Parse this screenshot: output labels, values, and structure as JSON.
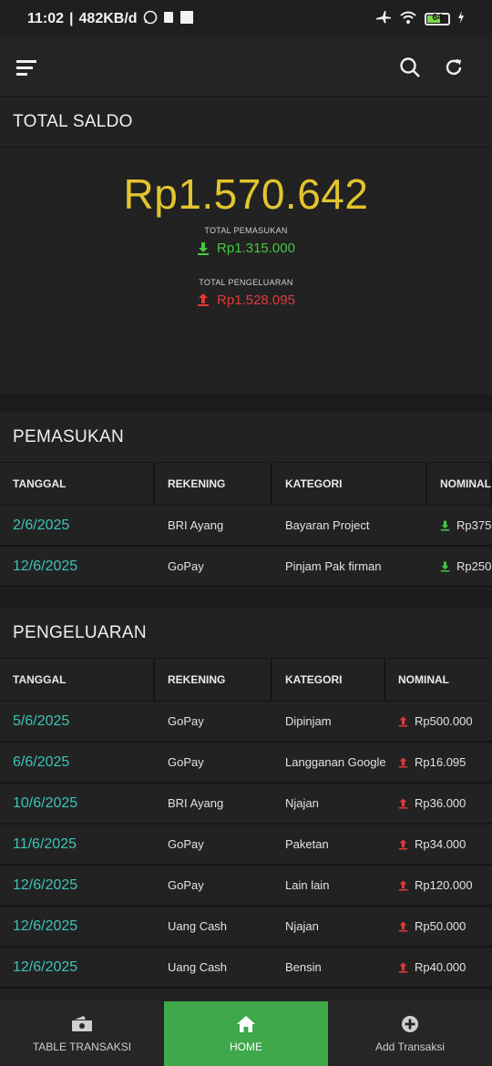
{
  "status_bar": {
    "time": "11:02",
    "speed": "482KB/d",
    "battery": "64"
  },
  "total_saldo": {
    "title": "TOTAL SALDO",
    "amount": "Rp1.570.642",
    "pemasukan_label": "TOTAL PEMASUKAN",
    "pemasukan_value": "Rp1.315.000",
    "pengeluaran_label": "TOTAL PENGELUARAN",
    "pengeluaran_value": "Rp1.528.095"
  },
  "pemasukan": {
    "title": "PEMASUKAN",
    "headers": [
      "TANGGAL",
      "REKENING",
      "KATEGORI",
      "NOMINAL"
    ],
    "rows": [
      {
        "tanggal": "2/6/2025",
        "rekening": "BRI Ayang",
        "kategori": "Bayaran Project",
        "nominal": "Rp375"
      },
      {
        "tanggal": "12/6/2025",
        "rekening": "GoPay",
        "kategori": "Pinjam Pak firman",
        "nominal": "Rp250"
      }
    ]
  },
  "pengeluaran": {
    "title": "PENGELUARAN",
    "headers": [
      "TANGGAL",
      "REKENING",
      "KATEGORI",
      "NOMINAL"
    ],
    "rows": [
      {
        "tanggal": "5/6/2025",
        "rekening": "GoPay",
        "kategori": "Dipinjam",
        "nominal": "Rp500.000"
      },
      {
        "tanggal": "6/6/2025",
        "rekening": "GoPay",
        "kategori": "Langganan Google",
        "nominal": "Rp16.095"
      },
      {
        "tanggal": "10/6/2025",
        "rekening": "BRI Ayang",
        "kategori": "Njajan",
        "nominal": "Rp36.000"
      },
      {
        "tanggal": "11/6/2025",
        "rekening": "GoPay",
        "kategori": "Paketan",
        "nominal": "Rp34.000"
      },
      {
        "tanggal": "12/6/2025",
        "rekening": "GoPay",
        "kategori": "Lain lain",
        "nominal": "Rp120.000"
      },
      {
        "tanggal": "12/6/2025",
        "rekening": "Uang Cash",
        "kategori": "Njajan",
        "nominal": "Rp50.000"
      },
      {
        "tanggal": "12/6/2025",
        "rekening": "Uang Cash",
        "kategori": "Bensin",
        "nominal": "Rp40.000"
      }
    ]
  },
  "bottom_nav": [
    {
      "label": "TABLE TRANSAKSI",
      "icon": "money-icon",
      "active": false
    },
    {
      "label": "HOME",
      "icon": "home-icon",
      "active": true
    },
    {
      "label": "Add Transaksi",
      "icon": "plus-circle-icon",
      "active": false
    }
  ],
  "colors": {
    "accent_gold": "#e2c42e",
    "income_green": "#42c842",
    "expense_red": "#e23a3a",
    "date_teal": "#3bc4b6",
    "nav_active": "#3fa84a"
  }
}
